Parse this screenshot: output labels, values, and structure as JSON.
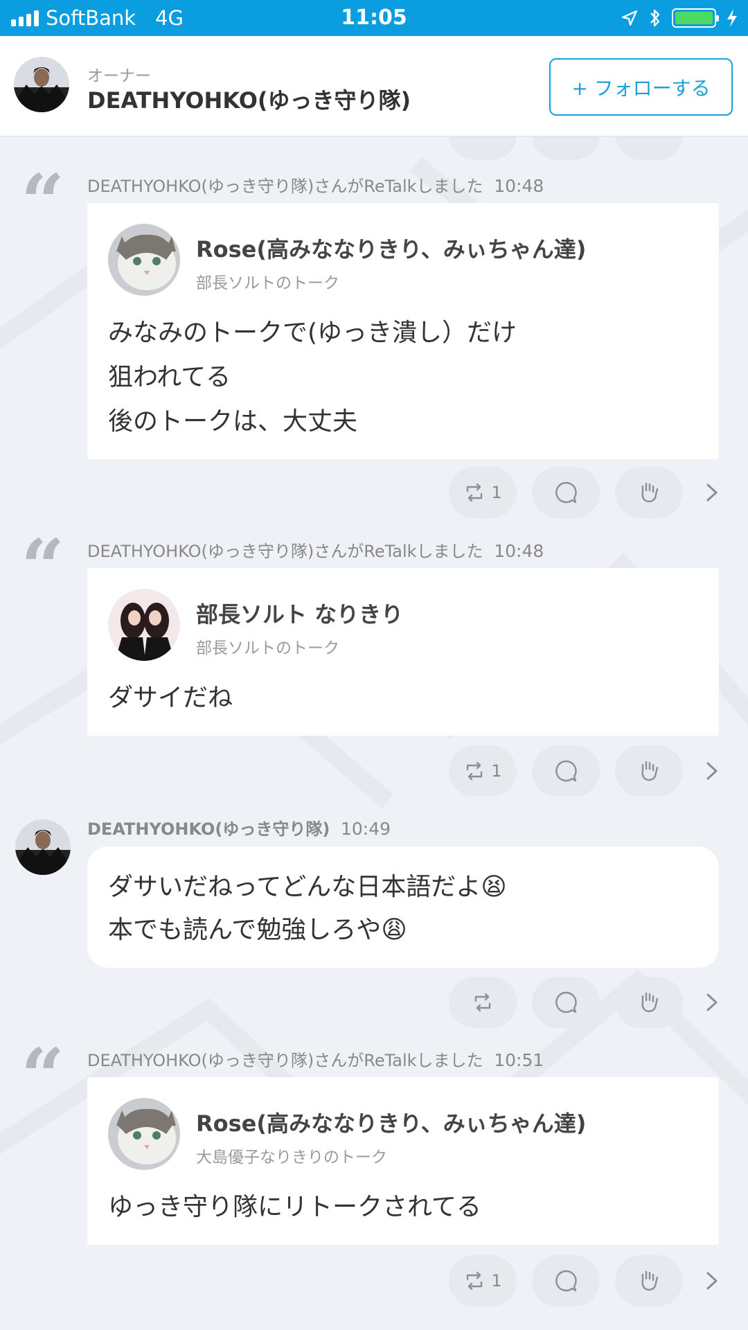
{
  "status_bar": {
    "carrier": "SoftBank",
    "network": "4G",
    "time": "11:05"
  },
  "header": {
    "role": "オーナー",
    "name": "DEATHYOHKO(ゆっき守り隊)",
    "follow_label": "+ フォローする"
  },
  "posts": [
    {
      "kind": "retalk",
      "retalk_text": "DEATHYOHKO(ゆっき守り隊)さんがReTalkしました",
      "time": "10:48",
      "author": "Rose(高みななりきり、みぃちゃん達)",
      "talk": "部長ソルトのトーク",
      "lines": [
        "みなみのトークで(ゆっき潰し）だけ",
        "狙われてる",
        "後のトークは、大丈夫"
      ],
      "retalk_count": "1"
    },
    {
      "kind": "retalk",
      "retalk_text": "DEATHYOHKO(ゆっき守り隊)さんがReTalkしました",
      "time": "10:48",
      "author": "部長ソルト なりきり",
      "talk": "部長ソルトのトーク",
      "lines": [
        "ダサイだね"
      ],
      "retalk_count": "1"
    },
    {
      "kind": "own",
      "author": "DEATHYOHKO(ゆっき守り隊)",
      "time": "10:49",
      "lines": [
        "ダサいだねってどんな日本語だよ😫",
        "本でも読んで勉強しろや😩"
      ],
      "retalk_count": ""
    },
    {
      "kind": "retalk",
      "retalk_text": "DEATHYOHKO(ゆっき守り隊)さんがReTalkしました",
      "time": "10:51",
      "author": "Rose(高みななりきり、みぃちゃん達)",
      "talk": "大島優子なりきりのトーク",
      "lines": [
        "ゆっき守り隊にリトークされてる"
      ],
      "retalk_count": "1"
    }
  ],
  "colors": {
    "status_bar": "#0a9de0",
    "accent": "#1aa0d8",
    "feed_bg": "#eef1f5"
  },
  "icons": [
    "retalk-icon",
    "comment-icon",
    "clap-icon",
    "chevron-right-icon"
  ]
}
